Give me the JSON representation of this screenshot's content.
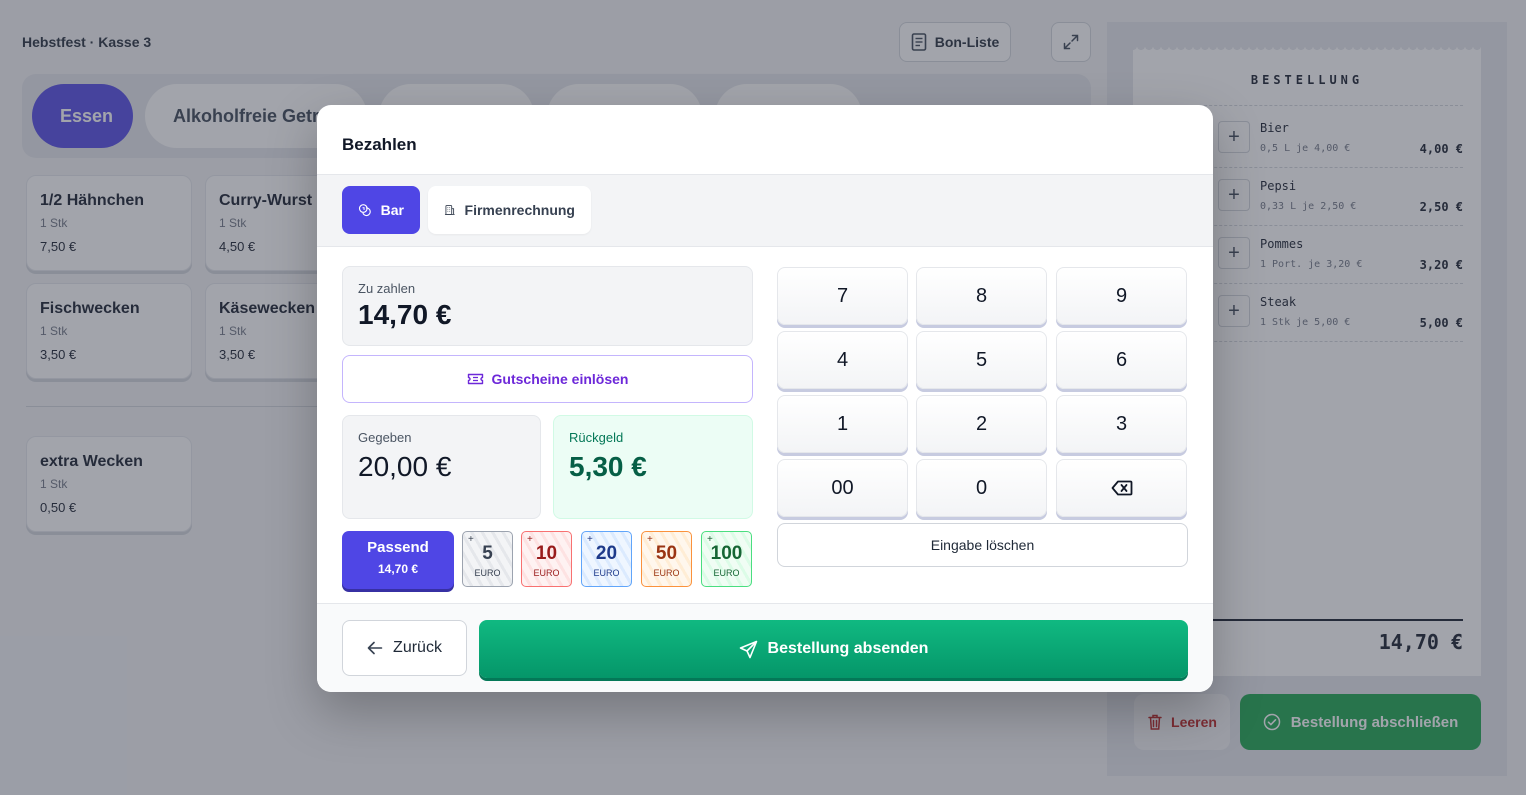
{
  "app": {
    "title": "Hebstfest · Kasse 3",
    "bon_list_label": "Bon-Liste"
  },
  "categories": [
    {
      "label": "Essen",
      "active": true
    },
    {
      "label": "Alkoholfreie Getränke",
      "active": false
    },
    {
      "label": "",
      "active": false
    },
    {
      "label": "",
      "active": false
    },
    {
      "label": "",
      "active": false
    }
  ],
  "products": [
    {
      "name": "1/2 Hähnchen",
      "unit": "1 Stk",
      "price": "7,50 €"
    },
    {
      "name": "Curry-Wurst",
      "unit": "1 Stk",
      "price": "4,50 €"
    },
    {
      "name": "Fischwecken",
      "unit": "1 Stk",
      "price": "3,50 €"
    },
    {
      "name": "Käsewecken",
      "unit": "1 Stk",
      "price": "3,50 €"
    },
    {
      "name": "extra Wecken",
      "unit": "1 Stk",
      "price": "0,50 €"
    }
  ],
  "receipt": {
    "title": "BESTELLUNG",
    "items": [
      {
        "name": "Bier",
        "detail": "0,5 L je 4,00 €",
        "price": "4,00 €"
      },
      {
        "name": "Pepsi",
        "detail": "0,33 L je 2,50 €",
        "price": "2,50 €"
      },
      {
        "name": "Pommes",
        "detail": "1 Port. je 3,20 €",
        "price": "3,20 €"
      },
      {
        "name": "Steak",
        "detail": "1 Stk je 5,00 €",
        "price": "5,00 €"
      }
    ],
    "total": "14,70 €",
    "clear_label": "Leeren",
    "finish_label": "Bestellung abschließen"
  },
  "modal": {
    "title": "Bezahlen",
    "tabs": [
      {
        "label": "Bar",
        "active": true
      },
      {
        "label": "Firmenrechnung",
        "active": false
      }
    ],
    "due_label": "Zu zahlen",
    "due_value": "14,70 €",
    "voucher_label": "Gutscheine einlösen",
    "given_label": "Gegeben",
    "given_value": "20,00 €",
    "change_label": "Rückgeld",
    "change_value": "5,30 €",
    "exact": {
      "label": "Passend",
      "amount": "14,70 €"
    },
    "notes": [
      {
        "plus": "+",
        "value": "5",
        "unit": "EURO"
      },
      {
        "plus": "+",
        "value": "10",
        "unit": "EURO"
      },
      {
        "plus": "+",
        "value": "20",
        "unit": "EURO"
      },
      {
        "plus": "+",
        "value": "50",
        "unit": "EURO"
      },
      {
        "plus": "+",
        "value": "100",
        "unit": "EURO"
      }
    ],
    "keypad": [
      "7",
      "8",
      "9",
      "4",
      "5",
      "6",
      "1",
      "2",
      "3",
      "00",
      "0"
    ],
    "clear_input_label": "Eingabe löschen",
    "back_label": "Zurück",
    "send_label": "Bestellung absenden"
  },
  "colors": {
    "primary": "#4f46e5",
    "success": "#10b981",
    "change_text": "#065f46",
    "voucher": "#6d28d9"
  }
}
